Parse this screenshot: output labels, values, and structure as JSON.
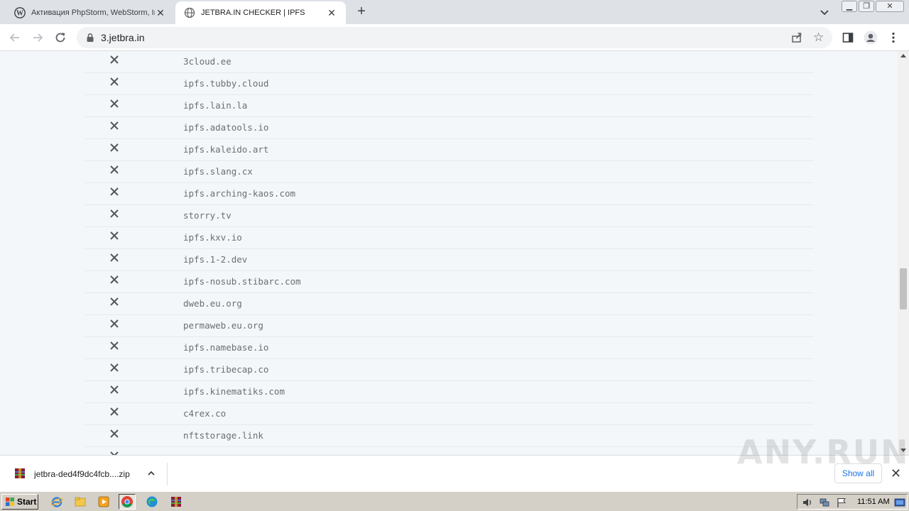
{
  "browser": {
    "tabs": [
      {
        "title": "Активация PhpStorm, WebStorm, IntelliJ IDEA",
        "active": false,
        "icon": "wordpress-icon"
      },
      {
        "title": "JETBRA.IN CHECKER | IPFS",
        "active": true,
        "icon": "globe-icon"
      }
    ],
    "url": "3.jetbra.in"
  },
  "checker": {
    "status_icon": "x-icon",
    "rows": [
      {
        "domain": "3cloud.ee"
      },
      {
        "domain": "ipfs.tubby.cloud"
      },
      {
        "domain": "ipfs.lain.la"
      },
      {
        "domain": "ipfs.adatools.io"
      },
      {
        "domain": "ipfs.kaleido.art"
      },
      {
        "domain": "ipfs.slang.cx"
      },
      {
        "domain": "ipfs.arching-kaos.com"
      },
      {
        "domain": "storry.tv"
      },
      {
        "domain": "ipfs.kxv.io"
      },
      {
        "domain": "ipfs.1-2.dev"
      },
      {
        "domain": "ipfs-nosub.stibarc.com"
      },
      {
        "domain": "dweb.eu.org"
      },
      {
        "domain": "permaweb.eu.org"
      },
      {
        "domain": "ipfs.namebase.io"
      },
      {
        "domain": "ipfs.tribecap.co"
      },
      {
        "domain": "ipfs.kinematiks.com"
      },
      {
        "domain": "c4rex.co"
      },
      {
        "domain": "nftstorage.link"
      },
      {
        "domain": ""
      }
    ]
  },
  "downloads": {
    "file": "jetbra-ded4f9dc4fcb....zip",
    "show_all": "Show all"
  },
  "watermark": "ANY.RUN",
  "taskbar": {
    "start": "Start",
    "time": "11:51 AM"
  }
}
